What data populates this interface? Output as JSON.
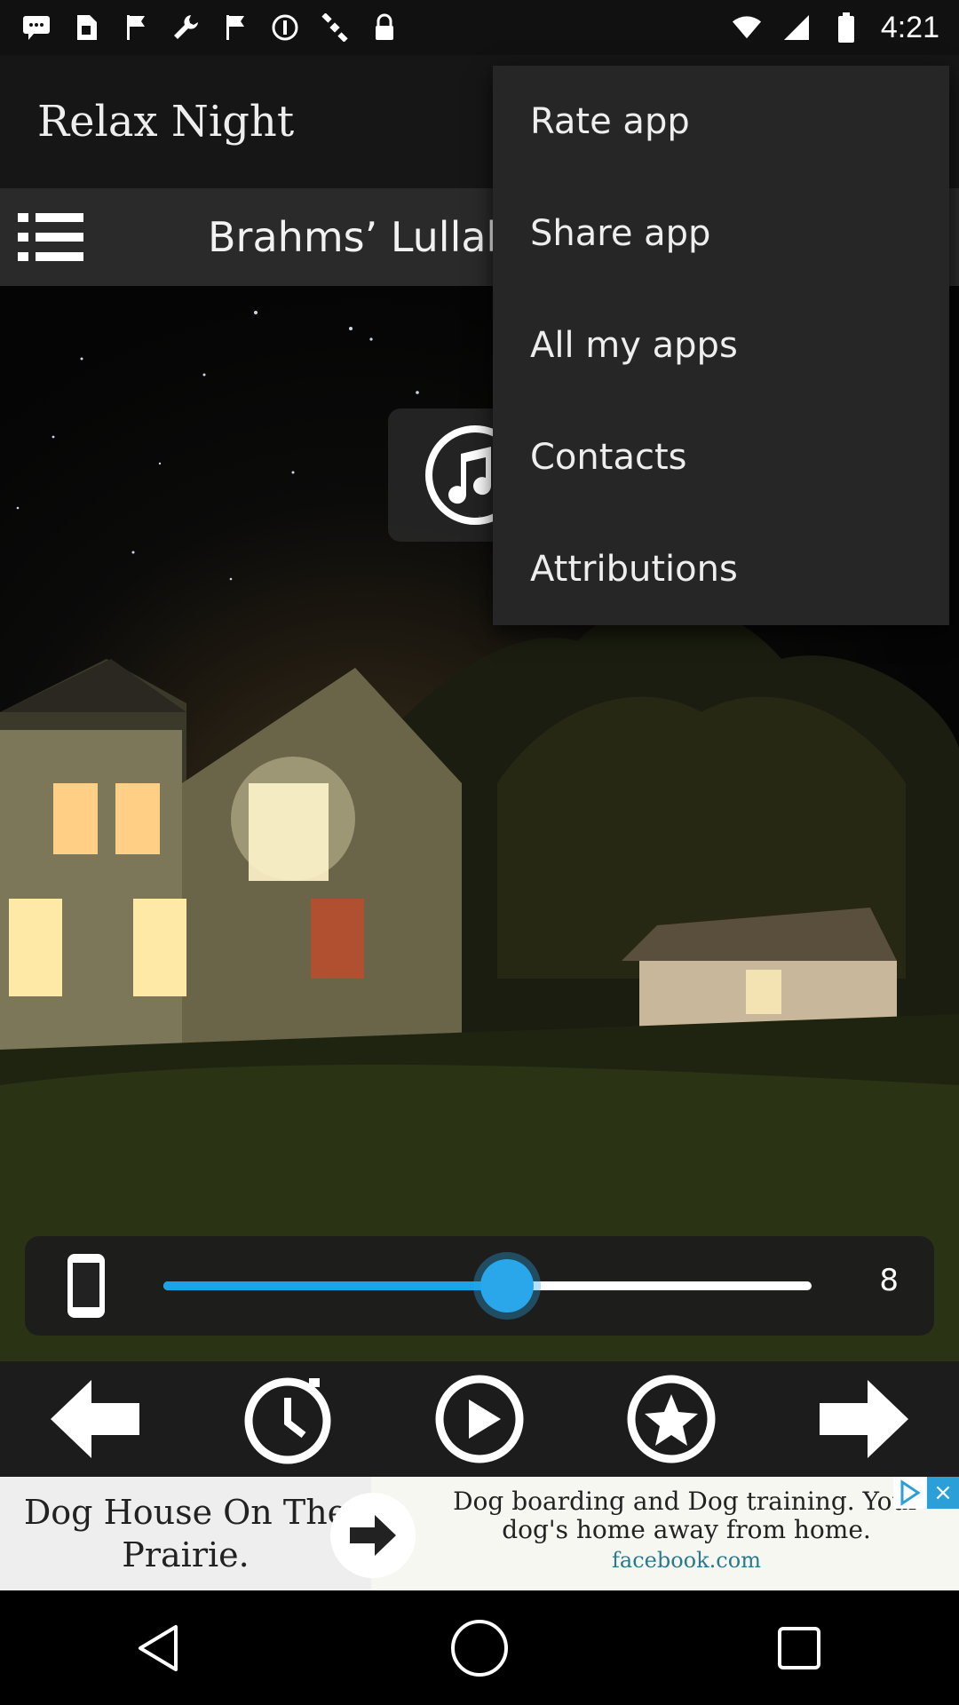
{
  "status_bar": {
    "time": "4:21",
    "icons": [
      "message-icon",
      "sim-icon",
      "flag-icon",
      "wrench-icon",
      "flag-icon",
      "sync-icon",
      "satellite-icon",
      "lock-icon",
      "wifi-icon",
      "signal-icon",
      "battery-icon"
    ]
  },
  "app_bar": {
    "title": "Relax Night"
  },
  "track": {
    "title": "Brahms’ Lullaby"
  },
  "volume": {
    "value": "8",
    "level_fraction": 0.53
  },
  "controls": [
    "previous-icon",
    "timer-icon",
    "play-icon",
    "favorite-icon",
    "next-icon"
  ],
  "ad": {
    "headline": "Dog House On The Prairie.",
    "body": "Dog boarding and Dog training. Your dog's home away from home.",
    "url": "facebook.com"
  },
  "menu": {
    "items": [
      {
        "label": "Rate app"
      },
      {
        "label": "Share app"
      },
      {
        "label": "All my apps"
      },
      {
        "label": "Contacts"
      },
      {
        "label": "Attributions"
      }
    ]
  }
}
